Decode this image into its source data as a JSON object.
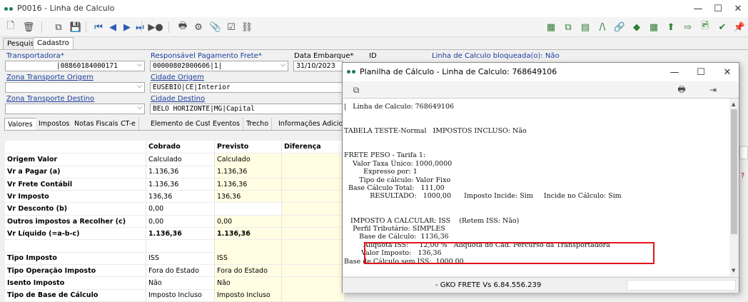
{
  "window": {
    "title": "P0016 - Linha de Calculo",
    "controls": [
      "—",
      "☐",
      "✕"
    ]
  },
  "toolbar": {
    "left_icons": [
      "new-document-icon",
      "delete-icon",
      "copy-icon",
      "save-icon",
      "first-record-icon",
      "previous-record-icon",
      "next-record-icon",
      "last-record-icon",
      "run-icon",
      "print-icon",
      "settings-icon",
      "attach-icon",
      "checkbox-icon",
      "link-icon"
    ],
    "left_glyphs": [
      "🗋",
      "🗑",
      "⧉",
      "💾",
      "⏮",
      "◀",
      "▶",
      "⏭",
      "▶●",
      "🖶",
      "⚙",
      "📎",
      "☑",
      "⛓"
    ],
    "right_icons": [
      "calculator-icon",
      "copy-sheet-icon",
      "grid-icon",
      "formula-icon",
      "chain-icon",
      "diamond-icon",
      "sheet-gear-icon",
      "upload-doc-icon",
      "export-icon",
      "image-edit-icon",
      "check-icon",
      "pin-icon"
    ],
    "right_glyphs": [
      "▦",
      "⧉",
      "▤",
      "/\\",
      "🔗",
      "◆",
      "▦",
      "⬆",
      "⇨",
      "🖻",
      "✔",
      "📌"
    ]
  },
  "main_tabs": [
    "Pesquisa",
    "Cadastro"
  ],
  "form": {
    "transportadora": {
      "label": "Transportadora*",
      "value": "|08860184000171"
    },
    "responsavel": {
      "label": "Responsável Pagamento Frete*",
      "value": "00000802000606|1|"
    },
    "data_embarque": {
      "label": "Data Embarque*",
      "value": "31/10/2023"
    },
    "id_label": "ID",
    "bloqueada": "Linha de Calculo bloqueada(o): Não",
    "zona_origem": {
      "label": "Zona Transporte Origem",
      "value": ""
    },
    "cidade_origem": {
      "label": "Cidade Origem",
      "value": "EUSEBIO|CE|Interior"
    },
    "zona_destino": {
      "label": "Zona Transporte Destino",
      "value": ""
    },
    "cidade_destino": {
      "label": "Cidade Destino",
      "value": "BELO HORIZONTE|MG|Capital"
    }
  },
  "subtabs": [
    "Valores",
    "Impostos",
    "Notas Fiscais",
    "CT-e",
    "Elemento de Custo",
    "Eventos",
    "Trecho",
    "Informações Adicionais"
  ],
  "grid": {
    "headers": [
      "",
      "Cobrado",
      "Previsto",
      "Diferença"
    ],
    "rows": [
      {
        "label": "Origem Valor",
        "cobrado": "Calculado",
        "previsto": "Calculado",
        "bold": false
      },
      {
        "label": "Vr a Pagar (a)",
        "cobrado": "1.136,36",
        "previsto": "1.136,36",
        "bold": false
      },
      {
        "label": "Vr Frete Contábil",
        "cobrado": "1.136,36",
        "previsto": "1.136,36",
        "bold": false
      },
      {
        "label": "Vr Imposto",
        "cobrado": "136,36",
        "previsto": "136,36",
        "bold": false
      },
      {
        "label": "Vr Desconto (b)",
        "cobrado": "0,00",
        "previsto": "",
        "bold": false
      },
      {
        "label": "Outros impostos a Recolher (c)",
        "cobrado": "0,00",
        "previsto": "0,00",
        "bold": false
      },
      {
        "label": "Vr Líquido (=a-b-c)",
        "cobrado": "1.136,36",
        "previsto": "1.136,36",
        "bold": true
      },
      {
        "label": "",
        "cobrado": "",
        "previsto": "",
        "bold": false
      },
      {
        "label": "Tipo Imposto",
        "cobrado": "ISS",
        "previsto": "ISS",
        "bold": false
      },
      {
        "label": "Tipo Operação Imposto",
        "cobrado": "Fora do Estado",
        "previsto": "Fora do Estado",
        "bold": false
      },
      {
        "label": "Isento Imposto",
        "cobrado": "Não",
        "previsto": "Não",
        "bold": false
      },
      {
        "label": "Tipo de Base de Cálculo",
        "cobrado": "Imposto Incluso",
        "previsto": "Imposto Incluso",
        "bold": false
      }
    ]
  },
  "dialog": {
    "title": "Planilha de Cálculo - Linha de Calculo: 768649106",
    "controls": [
      "—",
      "☐",
      "✕"
    ],
    "report_lines": [
      "|   Linha de Calculo: 768649106",
      "",
      "",
      "TABELA TESTE-Normal   IMPOSTOS INCLUSO: Não",
      "",
      "",
      "FRETE PESO - Tarifa 1:",
      "    Valor Taxa Único: 1000,0000",
      "         Expresso por: 1",
      "       Tipo de cálculo: Valor Fixo",
      "  Base Cálculo Total:   111,00",
      "            RESULTADO:   1000,00      Imposto Incide: Sim     Incide no Cálculo: Sim",
      "",
      "",
      "   IMPOSTO A CALCULAR: ISS    (Retem ISS: Não)",
      "    Perfil Tributário: SIMPLES",
      "       Base de Cálculo:  1136,36",
      "         Aliquota ISS:     12,00 %   Aliquota do Cad. Percurso da Transportadora",
      "        Valor Imposto:   136,36",
      "Base de Cálculo sem ISS:  1000,00"
    ],
    "status": "- GKO FRETE Vs 6.84.556.239"
  }
}
